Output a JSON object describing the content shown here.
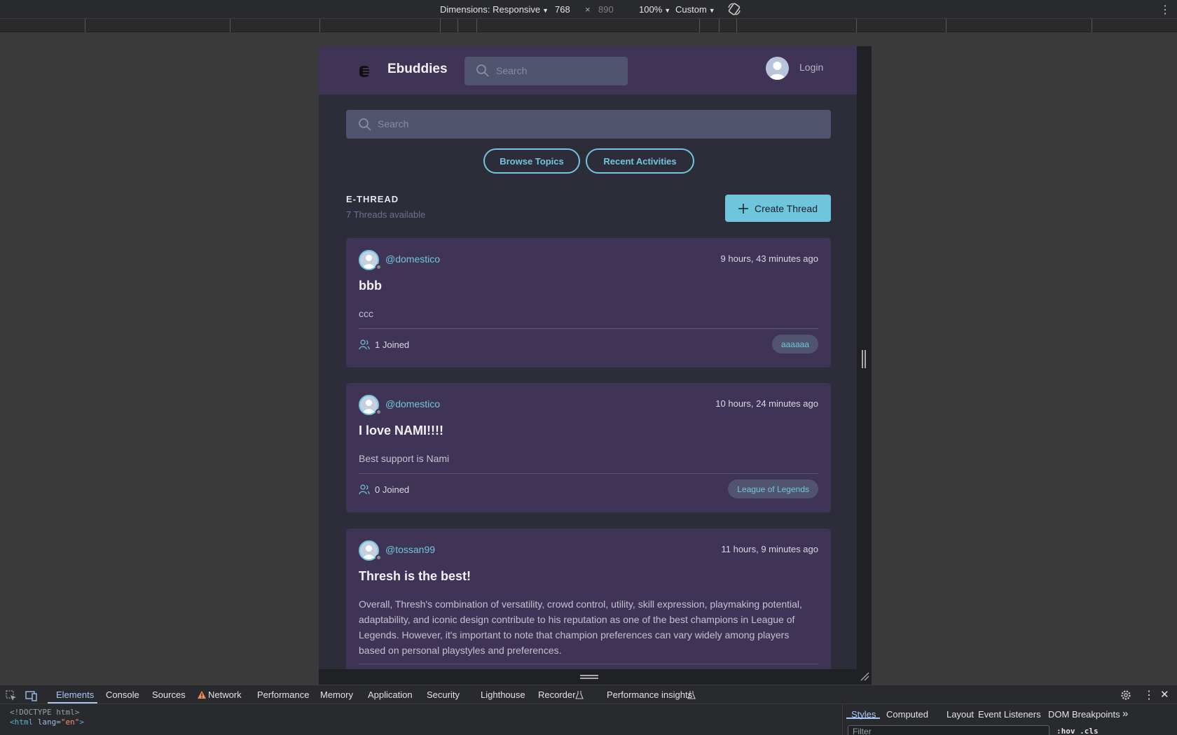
{
  "device_toolbar": {
    "dimensions_label": "Dimensions: Responsive",
    "width": "768",
    "times": "×",
    "height": "890",
    "zoom": "100%",
    "throttle": "Custom"
  },
  "app": {
    "brand": "Ebuddies",
    "header_search_placeholder": "Search",
    "login_label": "Login",
    "main_search_placeholder": "Search",
    "browse_topics_label": "Browse Topics",
    "recent_activities_label": "Recent Activities",
    "section_title": "E-THREAD",
    "threads_count": "7 Threads available",
    "create_thread_label": "Create Thread",
    "threads": [
      {
        "user": "@domestico",
        "time": "9 hours, 43 minutes ago",
        "title": "bbb",
        "body": "ccc",
        "joined": "1 Joined",
        "tag": "aaaaaa"
      },
      {
        "user": "@domestico",
        "time": "10 hours, 24 minutes ago",
        "title": "I love NAMI!!!!",
        "body": "Best support is Nami",
        "joined": "0 Joined",
        "tag": "League of Legends"
      },
      {
        "user": "@tossan99",
        "time": "11 hours, 9 minutes ago",
        "title": "Thresh is the best!",
        "body": "Overall, Thresh's combination of versatility, crowd control, utility, skill expression, playmaking potential, adaptability, and iconic design contribute to his reputation as one of the best champions in League of Legends. However, it's important to note that champion preferences can vary widely among players based on personal playstyles and preferences."
      }
    ]
  },
  "devtools": {
    "tabs": [
      "Elements",
      "Console",
      "Sources",
      "Network",
      "Performance",
      "Memory",
      "Application",
      "Security",
      "Lighthouse",
      "Recorder",
      "Performance insights"
    ],
    "code_line1": "<!DOCTYPE html>",
    "code_line2_tag": "<html",
    "code_line2_attr": " lang=",
    "code_line2_val": "\"en\"",
    "code_line2_end": ">",
    "right_tabs": [
      "Styles",
      "Computed",
      "Layout",
      "Event Listeners",
      "DOM Breakpoints"
    ],
    "filter_placeholder": "Filter",
    "hov_cls": ":hov  .cls"
  },
  "colors": {
    "accent": "#71c6dd",
    "card_bg": "#3f3456",
    "page_bg": "#2d2d39"
  }
}
